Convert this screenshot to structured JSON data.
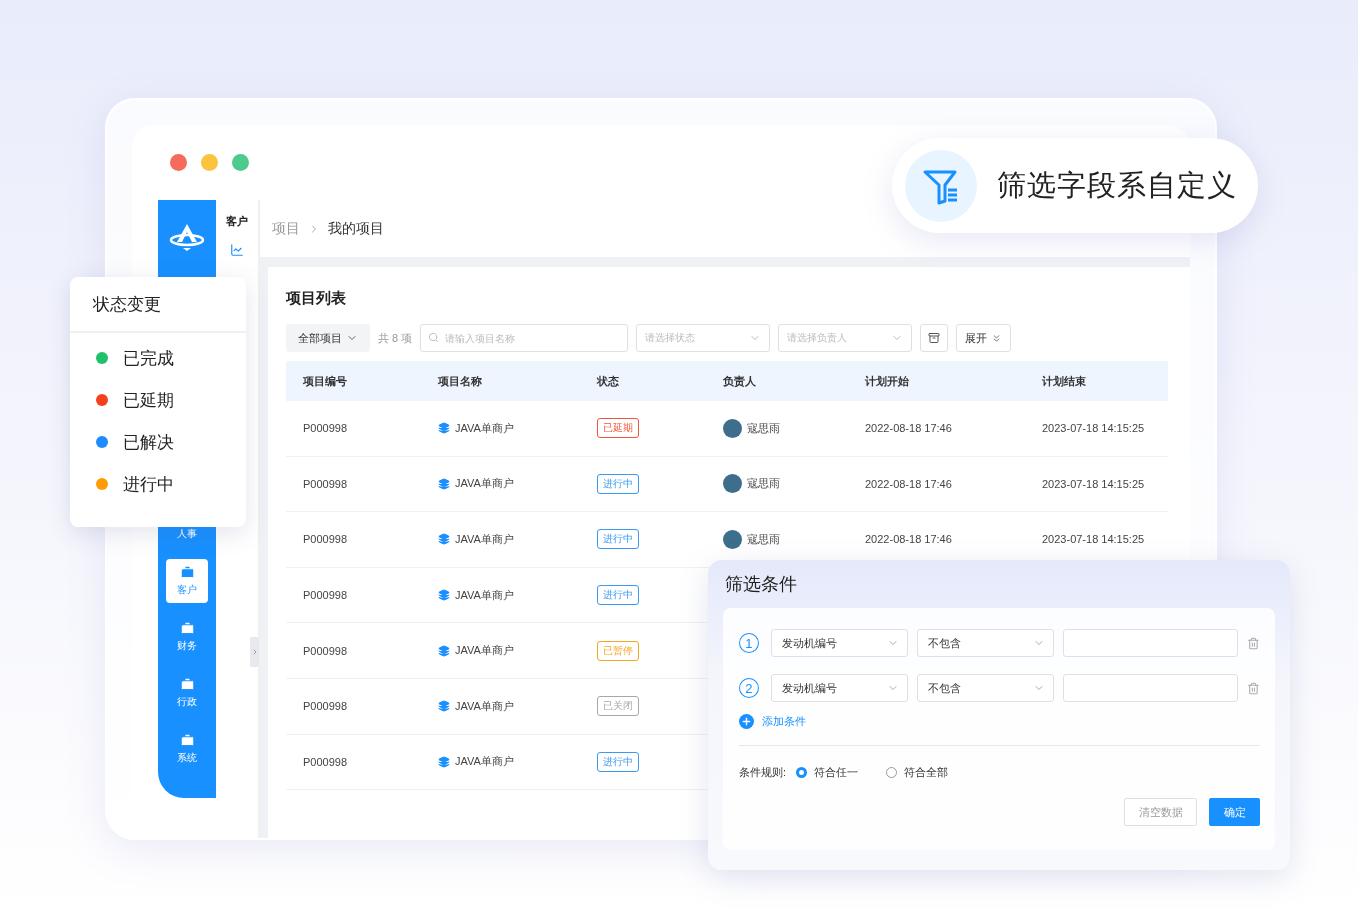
{
  "feature_badge": {
    "text": "筛选字段系自定义"
  },
  "sidebar": {
    "items": [
      {
        "label": "人事",
        "selected": false
      },
      {
        "label": "客户",
        "selected": true
      },
      {
        "label": "财务",
        "selected": false
      },
      {
        "label": "行政",
        "selected": false
      },
      {
        "label": "系统",
        "selected": false
      }
    ]
  },
  "subnav": {
    "title": "客户"
  },
  "breadcrumb": [
    "项目",
    "我的项目"
  ],
  "page_title": "项目列表",
  "toolbar": {
    "scope": "全部项目",
    "count": "共 8 项",
    "search": {
      "placeholder": "请输入项目名称"
    },
    "status_select": {
      "placeholder": "请选择状态"
    },
    "owner_select": {
      "placeholder": "请选择负责人"
    },
    "expand": "展开"
  },
  "table": {
    "columns": [
      "项目编号",
      "项目名称",
      "状态",
      "负责人",
      "计划开始",
      "计划结束"
    ],
    "rows": [
      {
        "id": "P000998",
        "name": "JAVA单商户",
        "status": {
          "label": "已延期",
          "color": "#f0563e"
        },
        "owner": "寇思雨",
        "start": "2022-08-18 17:46",
        "end": "2023-07-18 14:15:25"
      },
      {
        "id": "P000998",
        "name": "JAVA单商户",
        "status": {
          "label": "进行中",
          "color": "#3a9bf0"
        },
        "owner": "寇思雨",
        "start": "2022-08-18 17:46",
        "end": "2023-07-18 14:15:25"
      },
      {
        "id": "P000998",
        "name": "JAVA单商户",
        "status": {
          "label": "进行中",
          "color": "#3a9bf0"
        },
        "owner": "寇思雨",
        "start": "2022-08-18 17:46",
        "end": "2023-07-18 14:15:25"
      },
      {
        "id": "P000998",
        "name": "JAVA单商户",
        "status": {
          "label": "进行中",
          "color": "#3a9bf0"
        }
      },
      {
        "id": "P000998",
        "name": "JAVA单商户",
        "status": {
          "label": "已暂停",
          "color": "#f5a623"
        }
      },
      {
        "id": "P000998",
        "name": "JAVA单商户",
        "status": {
          "label": "已关闭",
          "color": "#a8a8a8"
        }
      },
      {
        "id": "P000998",
        "name": "JAVA单商户",
        "status": {
          "label": "进行中",
          "color": "#3a9bf0"
        }
      }
    ]
  },
  "status_menu": {
    "title": "状态变更",
    "items": [
      {
        "label": "已完成",
        "color": "#1fc26b"
      },
      {
        "label": "已延期",
        "color": "#f5401f"
      },
      {
        "label": "已解决",
        "color": "#1e8cff"
      },
      {
        "label": "进行中",
        "color": "#ff9a0a"
      }
    ]
  },
  "filter_panel": {
    "title": "筛选条件",
    "conditions": [
      {
        "number": "1",
        "field": "发动机编号",
        "operator": "不包含"
      },
      {
        "number": "2",
        "field": "发动机编号",
        "operator": "不包含"
      }
    ],
    "add": "添加条件",
    "rule": {
      "label": "条件规则:",
      "options": [
        {
          "label": "符合任一",
          "selected": true
        },
        {
          "label": "符合全部",
          "selected": false
        }
      ]
    },
    "buttons": {
      "clear": "清空数据",
      "confirm": "确定"
    }
  }
}
